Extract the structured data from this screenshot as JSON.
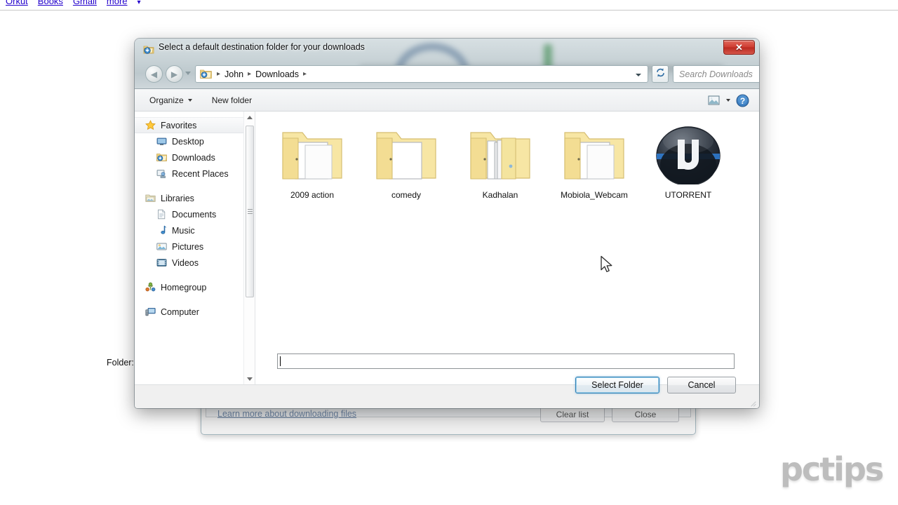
{
  "browser": {
    "links": [
      "Orkut",
      "Books",
      "Gmail",
      "more"
    ],
    "more_caret": "▾"
  },
  "background_window": {
    "learn_more_link": "Learn more about downloading files",
    "buttons": [
      {
        "label": "Clear list",
        "name": "clear-list-button"
      },
      {
        "label": "Close",
        "name": "close-downloads-button"
      }
    ]
  },
  "dialog": {
    "title": "Select a default destination folder for your downloads",
    "title_icon": "download-folder-icon",
    "close_icon": "close-icon",
    "navigation": {
      "back_icon": "back-arrow-icon",
      "forward_icon": "forward-arrow-icon",
      "history_dropdown_icon": "chevron-down-icon",
      "address_icon": "downloads-folder-icon",
      "breadcrumbs": [
        "John",
        "Downloads"
      ],
      "breadcrumb_separator": "▸",
      "address_dropdown_icon": "chevron-down-icon",
      "refresh_icon": "refresh-icon",
      "search_placeholder": "Search Downloads",
      "search_value": "",
      "search_icon": "search-icon"
    },
    "toolbar": {
      "organize_label": "Organize",
      "organize_caret": "▾",
      "new_folder_label": "New folder",
      "view_icon": "view-layout-icon",
      "view_caret_icon": "chevron-down-icon",
      "help_icon": "help-icon"
    },
    "sidebar": {
      "groups": [
        {
          "header": {
            "label": "Favorites",
            "icon": "star-icon",
            "selected": true
          },
          "items": [
            {
              "label": "Desktop",
              "icon": "desktop-icon"
            },
            {
              "label": "Downloads",
              "icon": "downloads-folder-icon"
            },
            {
              "label": "Recent Places",
              "icon": "recent-places-icon"
            }
          ]
        },
        {
          "header": {
            "label": "Libraries",
            "icon": "libraries-icon",
            "selected": false
          },
          "items": [
            {
              "label": "Documents",
              "icon": "document-icon"
            },
            {
              "label": "Music",
              "icon": "music-note-icon"
            },
            {
              "label": "Pictures",
              "icon": "picture-icon"
            },
            {
              "label": "Videos",
              "icon": "video-icon"
            }
          ]
        },
        {
          "header": {
            "label": "Homegroup",
            "icon": "homegroup-icon",
            "selected": false
          },
          "items": []
        },
        {
          "header": {
            "label": "Computer",
            "icon": "computer-icon",
            "selected": false
          },
          "items": []
        }
      ],
      "scrollbar": {
        "up_arrow_icon": "scroll-up-icon",
        "down_arrow_icon": "scroll-down-icon"
      }
    },
    "files": [
      {
        "name": "2009 action",
        "icon": "folder-open-icon"
      },
      {
        "name": "comedy",
        "icon": "folder-open-icon"
      },
      {
        "name": "Kadhalan",
        "icon": "folder-with-files-icon"
      },
      {
        "name": "Mobiola_Webcam",
        "icon": "folder-open-icon"
      },
      {
        "name": "UTORRENT",
        "icon": "utorrent-icon"
      }
    ],
    "footer": {
      "folder_label": "Folder:",
      "folder_value": "",
      "select_folder_label": "Select Folder",
      "cancel_label": "Cancel"
    }
  },
  "watermark": {
    "text": "pctips"
  },
  "colors": {
    "accent_blue": "#2f7fb5",
    "close_red": "#cf3d33",
    "folder_yellow": "#f5e49a",
    "link_blue": "#2200cc"
  }
}
